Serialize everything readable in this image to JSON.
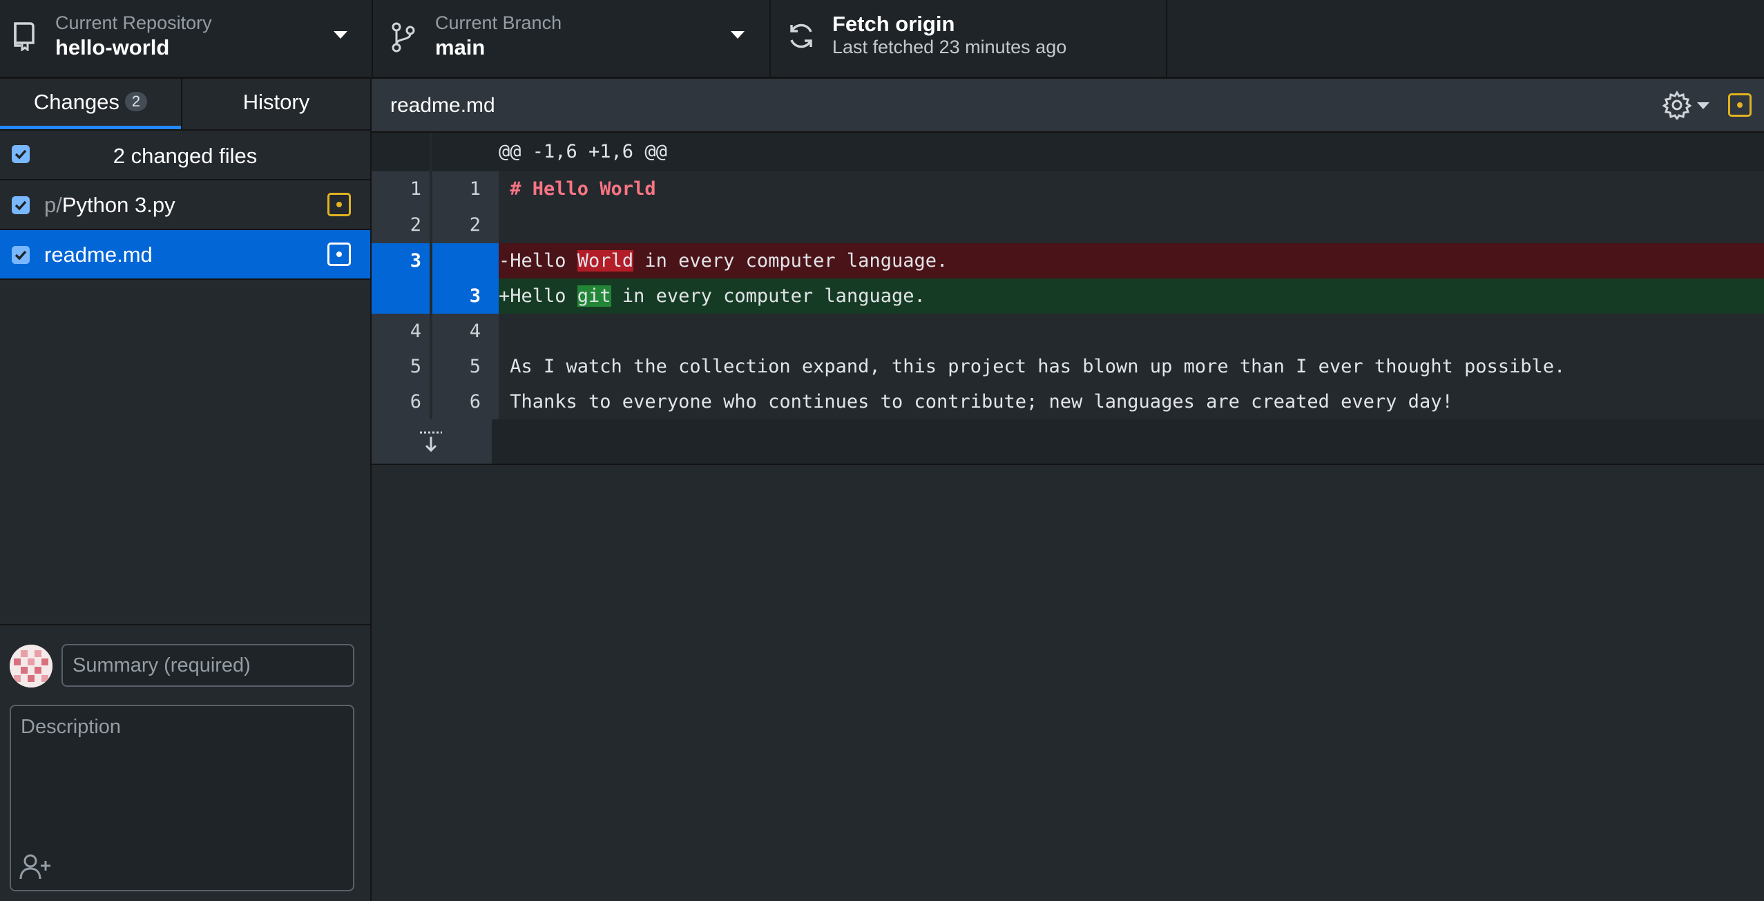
{
  "toolbar": {
    "repository": {
      "label": "Current Repository",
      "value": "hello-world"
    },
    "branch": {
      "label": "Current Branch",
      "value": "main"
    },
    "fetch": {
      "title": "Fetch origin",
      "subtitle": "Last fetched 23 minutes ago"
    }
  },
  "sidebar": {
    "tabs": [
      {
        "label": "Changes",
        "count": "2",
        "active": true
      },
      {
        "label": "History",
        "active": false
      }
    ],
    "changed_files_label": "2 changed files",
    "files": [
      {
        "dir": "p/",
        "name": "Python 3.py",
        "checked": true,
        "selected": false,
        "status_icon": "modified-icon"
      },
      {
        "dir": "",
        "name": "readme.md",
        "checked": true,
        "selected": true,
        "status_icon": "modified-icon"
      }
    ]
  },
  "commit": {
    "summary_placeholder": "Summary (required)",
    "description_placeholder": "Description"
  },
  "diff": {
    "file_title": "readme.md",
    "hunk_header": "@@ -1,6 +1,6 @@",
    "lines": [
      {
        "type": "context",
        "old": "1",
        "new": "1",
        "text": " # Hello World"
      },
      {
        "type": "context",
        "old": "2",
        "new": "2",
        "text": ""
      },
      {
        "type": "deleted",
        "old": "3",
        "new": "",
        "prefix": "-Hello ",
        "highlight": "World",
        "suffix": " in every computer language."
      },
      {
        "type": "added",
        "old": "",
        "new": "3",
        "prefix": "+Hello ",
        "highlight": "git",
        "suffix": " in every computer language."
      },
      {
        "type": "context",
        "old": "4",
        "new": "4",
        "text": ""
      },
      {
        "type": "context",
        "old": "5",
        "new": "5",
        "text": " As I watch the collection expand, this project has blown up more than I ever thought possible."
      },
      {
        "type": "context",
        "old": "6",
        "new": "6",
        "text": " Thanks to everyone who continues to contribute; new languages are created every day!"
      }
    ]
  },
  "colors": {
    "accent": "#0366d6",
    "modified": "#e2b321",
    "deleted_bg": "#4a1318",
    "added_bg": "#163b24"
  }
}
